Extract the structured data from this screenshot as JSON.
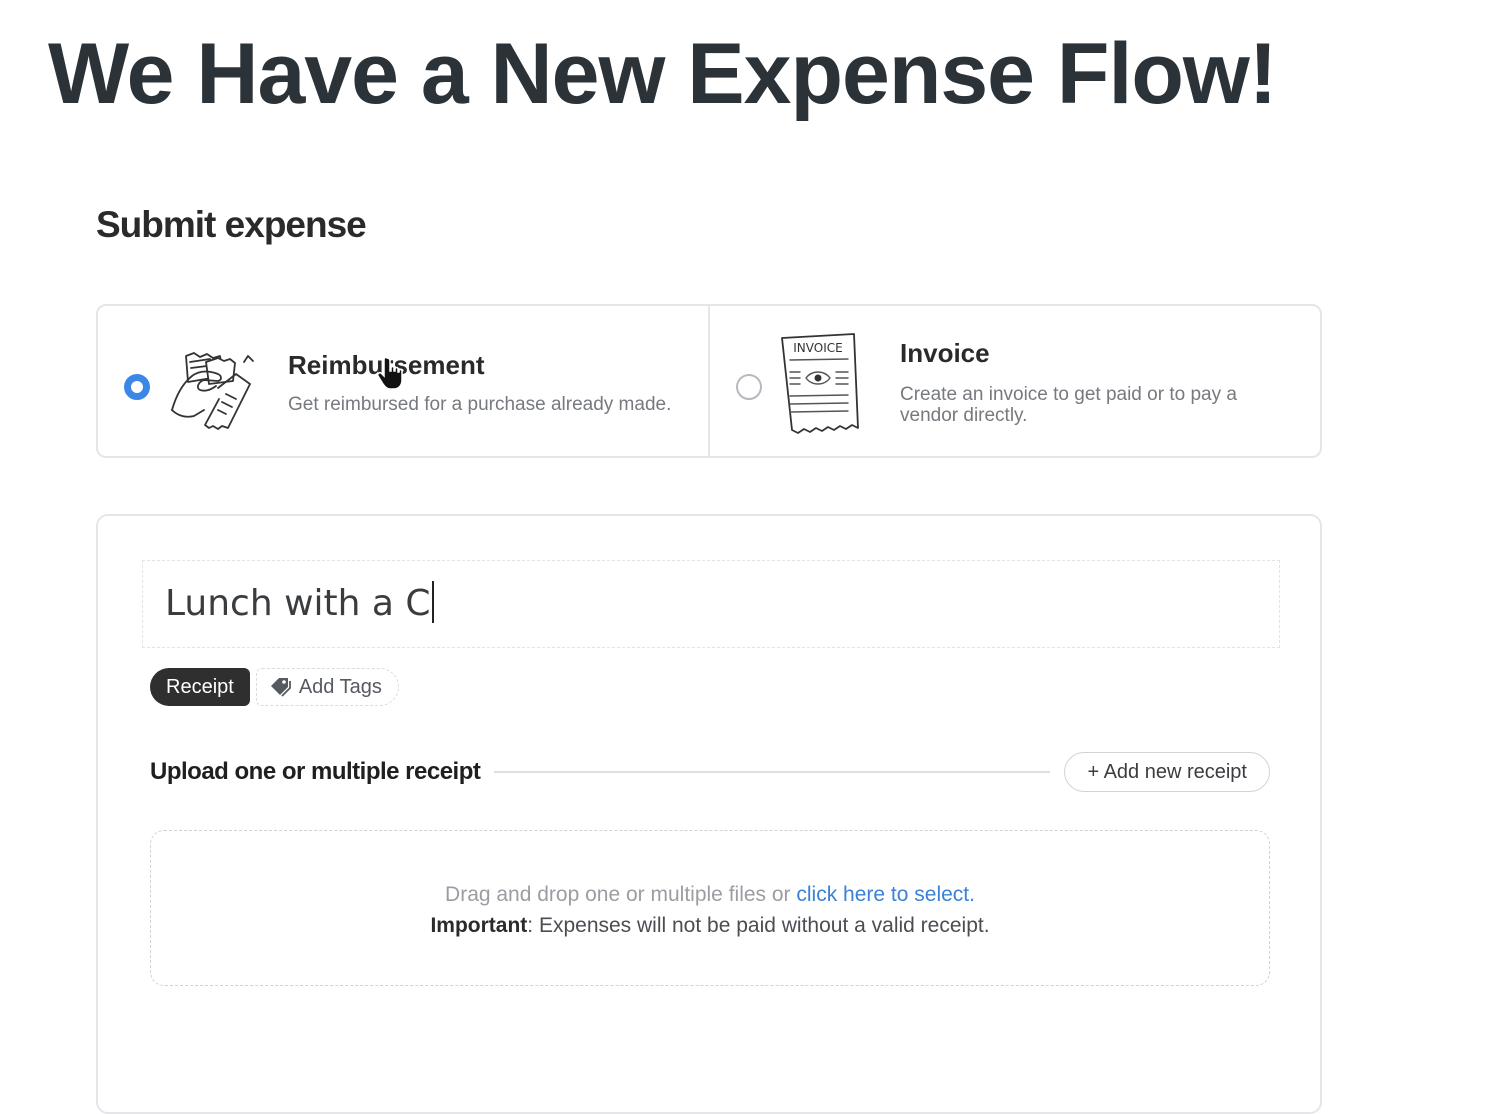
{
  "headline": "We Have a New Expense Flow!",
  "page_title": "Submit expense",
  "expense_types": {
    "reimbursement": {
      "title": "Reimbursement",
      "description": "Get reimbursed for a purchase already made.",
      "selected": true
    },
    "invoice": {
      "title": "Invoice",
      "description": "Create an invoice to get paid or to pay a vendor directly.",
      "illustration_label": "INVOICE",
      "selected": false
    }
  },
  "form": {
    "description_value": "Lunch with a C",
    "type_badge": "Receipt",
    "add_tags_label": "Add Tags",
    "upload_title": "Upload one or multiple receipt",
    "add_receipt_label": "+ Add new receipt",
    "dropzone": {
      "text_before_link": "Drag and drop one or multiple files or ",
      "link_text": "click here to select.",
      "important_label": "Important",
      "important_text": ": Expenses will not be paid without a valid receipt."
    }
  },
  "colors": {
    "accent": "#3c86e8",
    "link": "#3b82d6",
    "badge_bg": "#2f2f2f"
  },
  "icons": [
    "reimbursement-illustration",
    "invoice-illustration",
    "tag-icon",
    "hand-pointer-icon"
  ]
}
